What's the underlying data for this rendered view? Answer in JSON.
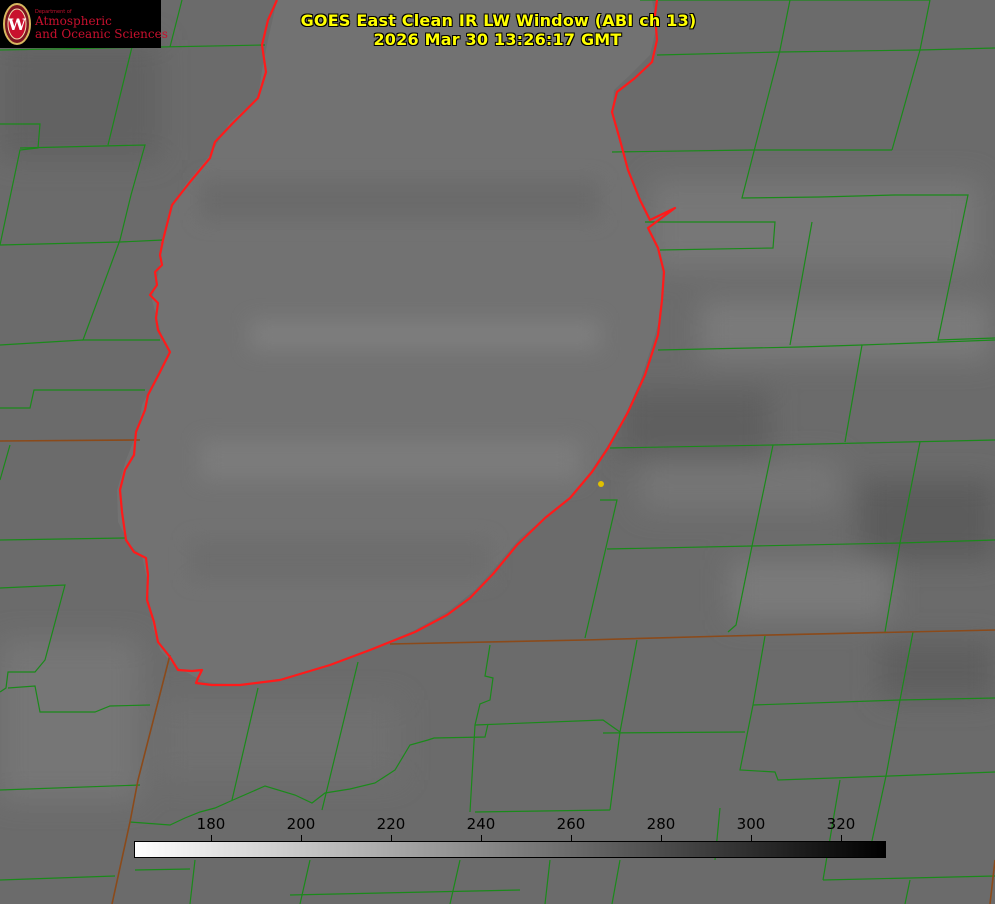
{
  "header": {
    "title_line1": "GOES East Clean IR LW Window (ABI ch 13)",
    "title_line2": "2026 Mar 30 13:26:17 GMT"
  },
  "logo": {
    "dept_small": "Department of",
    "dept_line1": "Atmospheric",
    "dept_line2": "and Oceanic Sciences",
    "seal_letter": "W"
  },
  "colorbar": {
    "tick_values": [
      "180",
      "200",
      "220",
      "240",
      "260",
      "280",
      "300",
      "320"
    ],
    "min": 163,
    "max": 330,
    "start_color": "#ffffff",
    "end_color": "#000000"
  },
  "colors": {
    "county_lines": "#1a8a1a",
    "state_lines": "#8b4a1a",
    "shoreline": "#ff1a1a",
    "title": "#ffff00",
    "marker": "#e0c000"
  }
}
